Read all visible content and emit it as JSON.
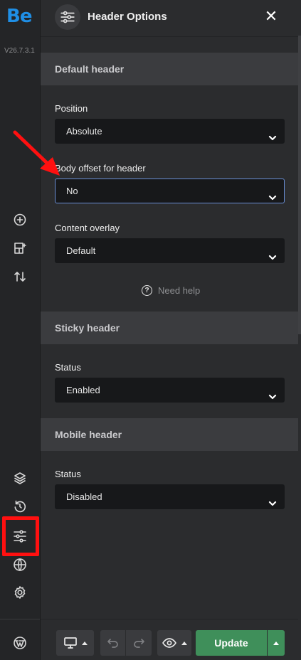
{
  "rail": {
    "logo": "Be",
    "version": "V26.7.3.1",
    "icons": [
      "add-circle-icon",
      "layout-add-icon",
      "sort-arrows-icon",
      "layers-icon",
      "history-icon",
      "sliders-icon",
      "globe-icon",
      "gear-icon",
      "wordpress-icon"
    ],
    "highlight_color": "#ff1010"
  },
  "header": {
    "title": "Header Options",
    "icon": "sliders-icon",
    "close_label": "✕"
  },
  "sections": {
    "default": {
      "title": "Default header",
      "position_label": "Position",
      "position_value": "Absolute",
      "body_offset_label": "Body offset for header",
      "body_offset_value": "No",
      "overlay_label": "Content overlay",
      "overlay_value": "Default",
      "help": "Need help"
    },
    "sticky": {
      "title": "Sticky header",
      "status_label": "Status",
      "status_value": "Enabled"
    },
    "mobile": {
      "title": "Mobile header",
      "status_label": "Status",
      "status_value": "Disabled"
    }
  },
  "toolbar": {
    "device_icon": "desktop-icon",
    "undo_icon": "undo-icon",
    "redo_icon": "redo-icon",
    "preview_icon": "eye-icon",
    "update_label": "Update"
  },
  "colors": {
    "accent_green": "#3f8f5a",
    "focus_border": "#6a8fd6",
    "annotation_red": "#ff1010",
    "logo_blue": "#1f8fe6"
  }
}
